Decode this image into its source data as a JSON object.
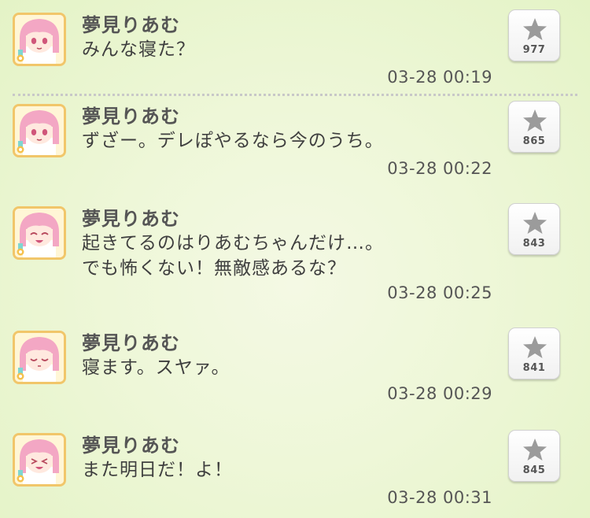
{
  "posts": [
    {
      "author": "夢見りあむ",
      "lines": [
        "みんな寝た？"
      ],
      "time": "03-28 00:19",
      "stars": "977"
    },
    {
      "author": "夢見りあむ",
      "lines": [
        "ずざー。デレぽやるなら今のうち。"
      ],
      "time": "03-28 00:22",
      "stars": "865"
    },
    {
      "author": "夢見りあむ",
      "lines": [
        "起きてるのはりあむちゃんだけ…。",
        "でも怖くない！無敵感あるな？"
      ],
      "time": "03-28 00:25",
      "stars": "843"
    },
    {
      "author": "夢見りあむ",
      "lines": [
        "寝ます。スヤァ。"
      ],
      "time": "03-28 00:29",
      "stars": "841"
    },
    {
      "author": "夢見りあむ",
      "lines": [
        "また明日だ！よ！"
      ],
      "time": "03-28 00:31",
      "stars": "845"
    }
  ],
  "icons": {
    "favorite": "star-icon",
    "avatar": "character-avatar",
    "badge": "flower-icon"
  },
  "colors": {
    "avatar_border": "#f1c66a",
    "hair": "#f3a7c4",
    "star": "#9b9b9b",
    "divider": "#c8c8c8"
  }
}
